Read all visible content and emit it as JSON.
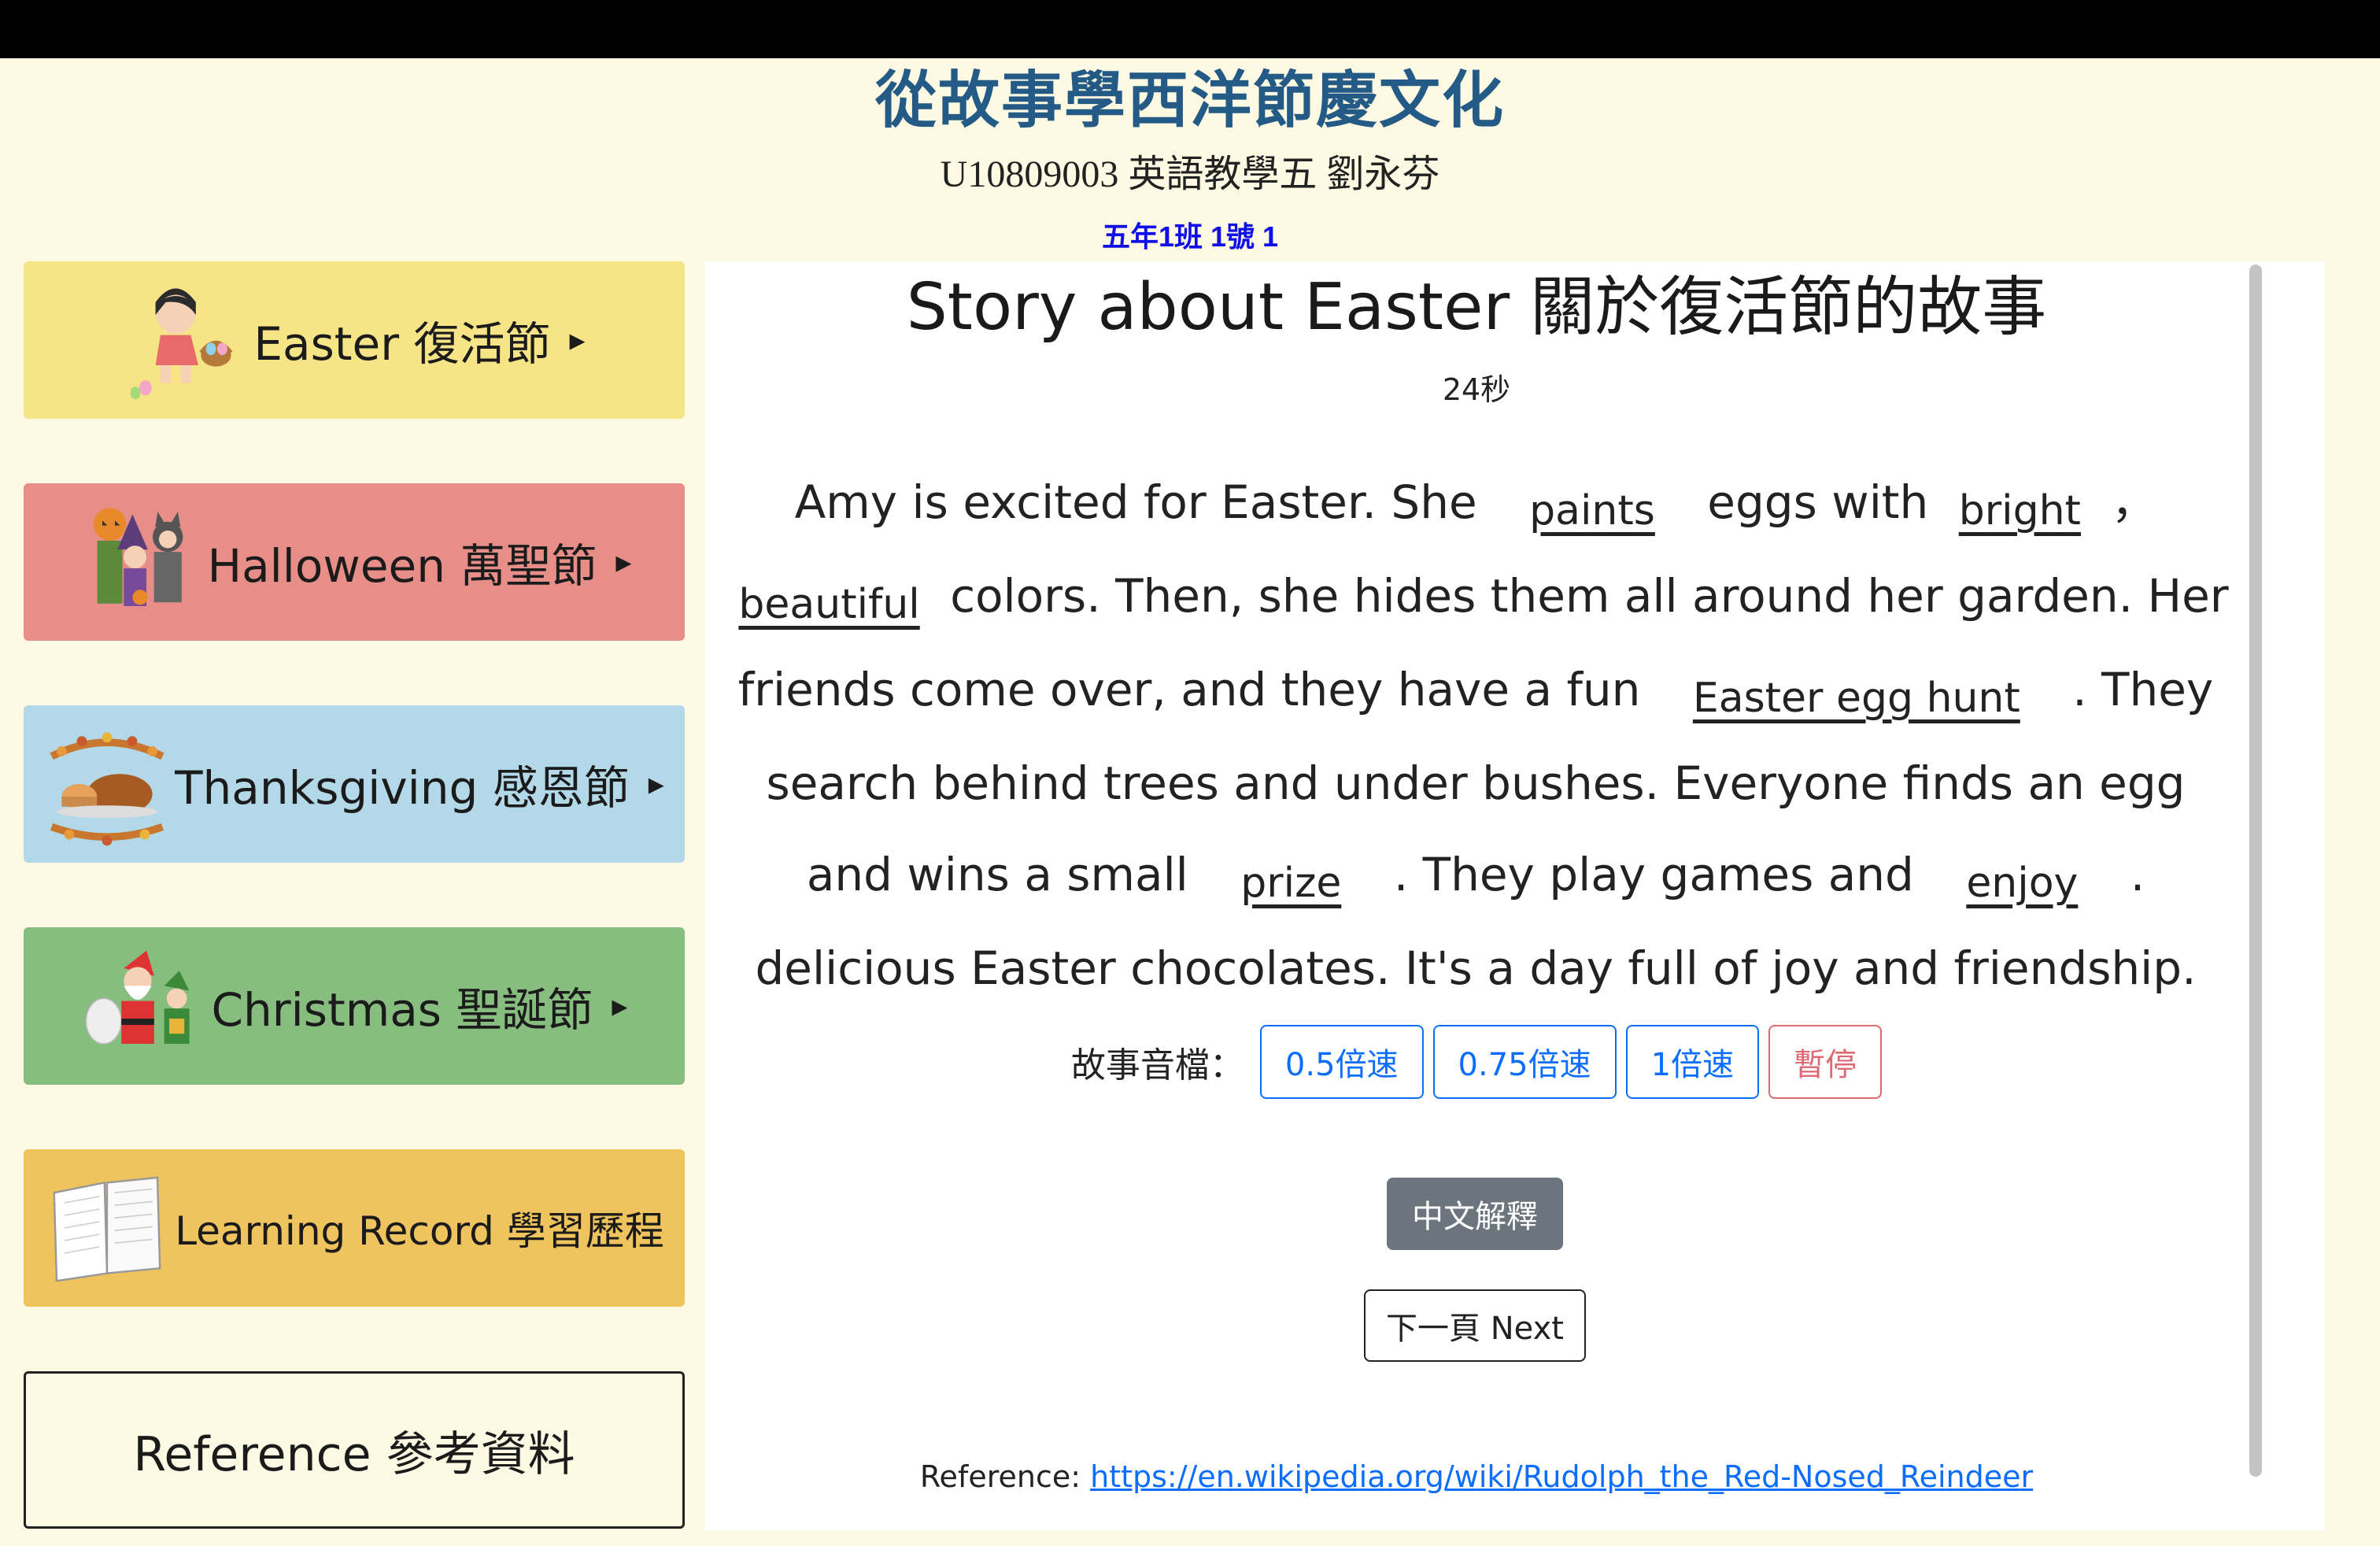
{
  "site": {
    "title": "從故事學西洋節慶文化",
    "subtitle": "U10809003 英語教學五 劉永芬",
    "class_info": "五年1班 1號 1"
  },
  "sidebar": {
    "items": [
      {
        "label": "Easter 復活節",
        "caret": "▸",
        "icon": "easter-girl-icon"
      },
      {
        "label": "Halloween 萬聖節",
        "caret": "▸",
        "icon": "halloween-kids-icon"
      },
      {
        "label": "Thanksgiving 感恩節",
        "caret": "▸",
        "icon": "thanksgiving-turkey-icon"
      },
      {
        "label": "Christmas 聖誕節",
        "caret": "▸",
        "icon": "santa-elf-icon"
      },
      {
        "label": "Learning Record 學習歷程",
        "icon": "open-book-icon"
      },
      {
        "label": "Reference 參考資料"
      }
    ]
  },
  "story": {
    "title": "Story about Easter 關於復活節的故事",
    "timer": "24秒",
    "parts": [
      "Amy is excited for Easter. She",
      "paints",
      "eggs with",
      "bright",
      "，",
      "beautiful",
      "colors. Then, she hides them all around her garden. Her friends come over, and they have a fun",
      "Easter egg hunt",
      ". They search behind trees and under bushes. Everyone finds an egg and wins a small",
      "prize",
      ". They play games and",
      "enjoy",
      ". delicious Easter chocolates. It's a day full of joy and friendship."
    ]
  },
  "audio": {
    "label": "故事音檔：",
    "buttons": [
      "0.5倍速",
      "0.75倍速",
      "1倍速",
      "暫停"
    ]
  },
  "actions": {
    "chinese": "中文解釋",
    "next": "下一頁 Next"
  },
  "reference": {
    "label": "Reference: ",
    "link": "https://en.wikipedia.org/wiki/Rudolph_the_Red-Nosed_Reindeer"
  },
  "colors": {
    "background": "#fef9e3",
    "title": "#245a86",
    "class_info": "#1010e6",
    "easter": "#f7e487",
    "halloween": "#e78e89",
    "thanksgiving": "#b3d8e8",
    "christmas": "#88bd80",
    "record": "#efc35d",
    "primary": "#0d6efd",
    "danger": "#dc6a72",
    "secondary": "#6c757d"
  }
}
